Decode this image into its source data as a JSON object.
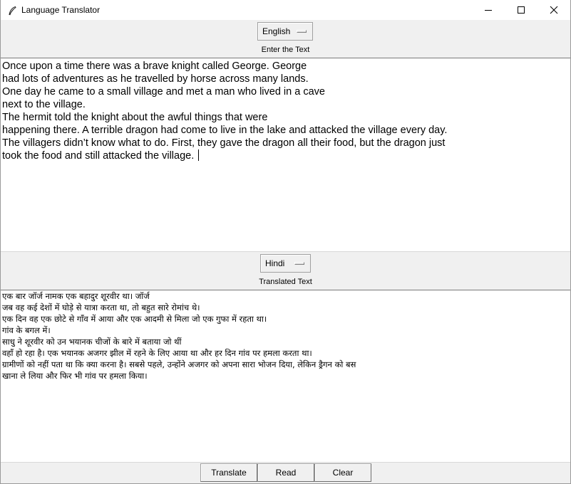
{
  "window": {
    "title": "Language Translator",
    "controls": [
      "minimize-icon",
      "maximize-icon",
      "close-icon"
    ]
  },
  "source": {
    "language": "English",
    "caption": "Enter the Text",
    "lines": [
      "Once upon a time there was a brave knight called George. George",
      "had lots of adventures as he travelled by horse across many lands.",
      "One day he came to a small village and met a man who lived in a cave",
      "next to the village.",
      "The hermit told the knight about the awful things that were",
      "happening there. A terrible dragon had come to live in the lake and attacked the village every day.",
      "The villagers didn’t know what to do. First, they gave the dragon all their food, but the dragon just",
      "took the food and still attacked the village. "
    ]
  },
  "target": {
    "language": "Hindi",
    "caption": "Translated Text",
    "lines": [
      "एक बार जॉर्ज नामक एक बहादुर शूरवीर था। जॉर्ज",
      "जब वह कई देशों में घोड़े से यात्रा करता था, तो बहुत सारे रोमांच थे।",
      "एक दिन वह एक छोटे से गाँव में आया और एक आदमी से मिला जो एक गुफा में रहता था।",
      "गांव के बगल में।",
      "साधु ने शूरवीर को उन भयानक चीजों के बारे में बताया जो थीं",
      "वहाँ हो रहा है। एक भयानक अजगर झील में रहने के लिए आया था और हर दिन गांव पर हमला करता था।",
      "ग्रामीणों को नहीं पता था कि क्या करना है। सबसे पहले, उन्होंने अजगर को अपना सारा भोजन दिया, लेकिन ड्रैगन को बस",
      "खाना ले लिया और फिर भी गांव पर हमला किया।"
    ]
  },
  "buttons": {
    "translate": "Translate",
    "read": "Read",
    "clear": "Clear"
  }
}
